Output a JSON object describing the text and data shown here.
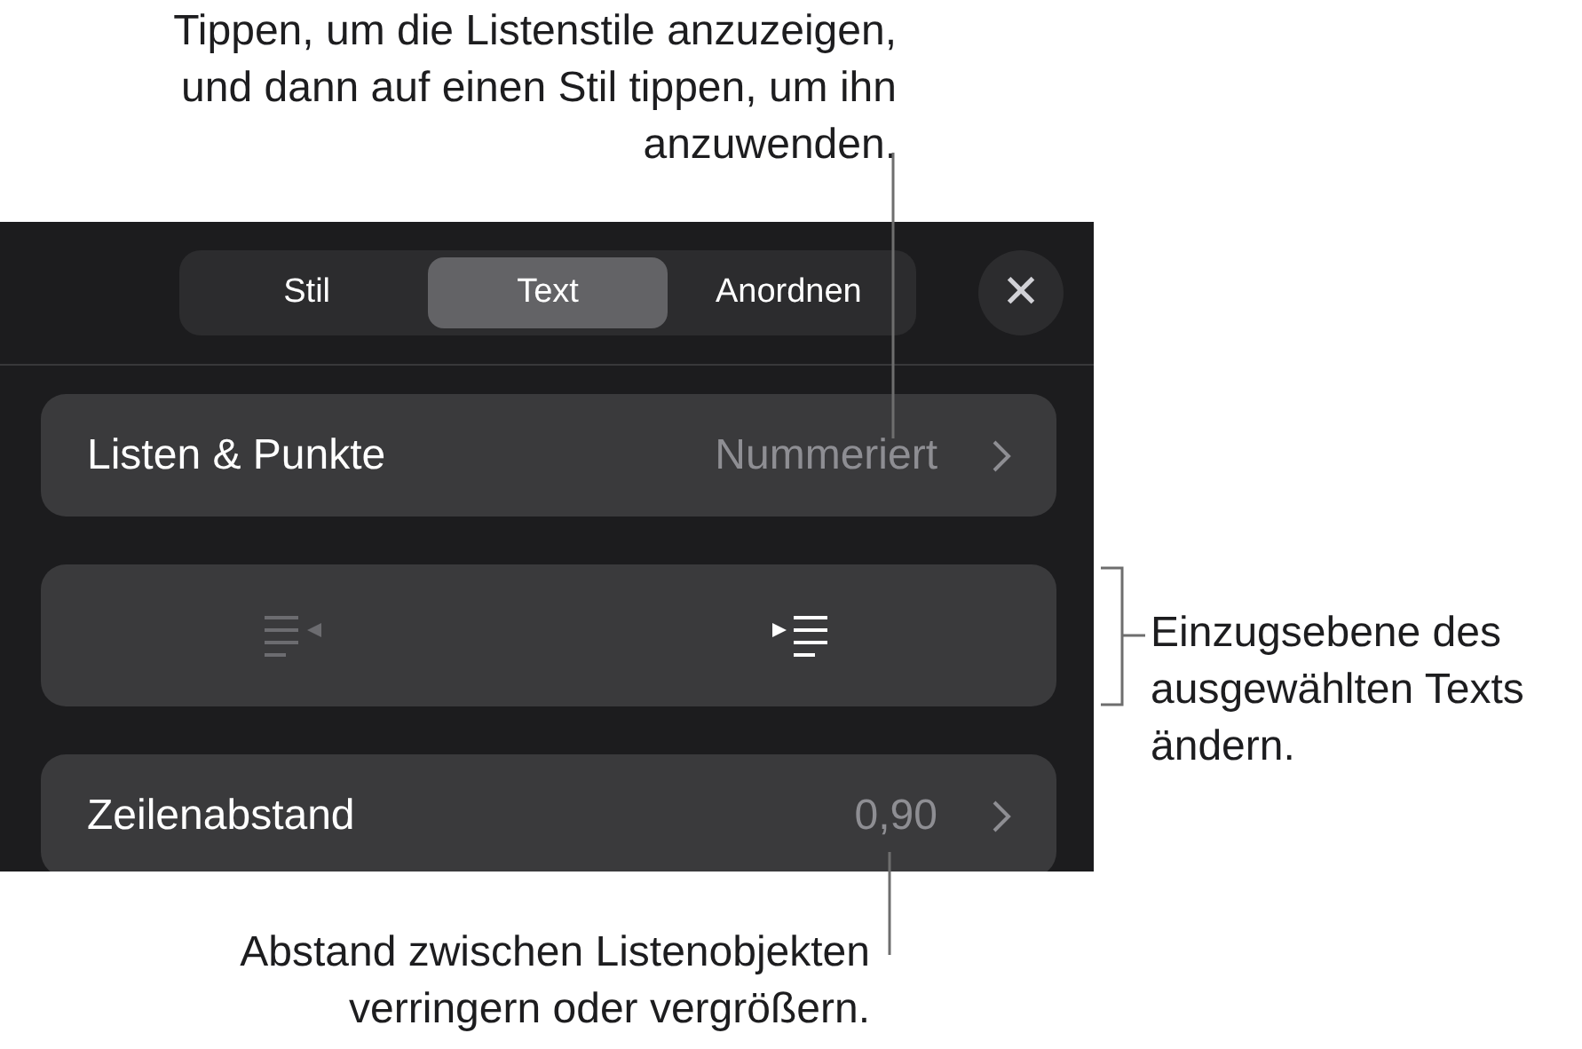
{
  "top_callout": "Tippen, um die Listenstile anzuzeigen, und dann auf einen Stil tippen, um ihn anzuwenden.",
  "right_callout": "Einzugsebene des ausgewählten Texts ändern.",
  "bottom_callout": "Abstand zwischen Listenobjekten verringern oder vergrößern.",
  "tabs": [
    {
      "label": "Stil",
      "selected": false
    },
    {
      "label": "Text",
      "selected": true
    },
    {
      "label": "Anordnen",
      "selected": false
    }
  ],
  "close_button": "✕",
  "rows": [
    {
      "kind": "disclosure",
      "label": "Listen & Punkte",
      "value": "Nummeriert"
    },
    {
      "kind": "indent",
      "buttons": [
        {
          "kind": "decrease",
          "disabled": true
        },
        {
          "kind": "increase",
          "disabled": false
        }
      ]
    },
    {
      "kind": "disclosure",
      "label": "Zeilenabstand",
      "value": "0,90"
    }
  ]
}
